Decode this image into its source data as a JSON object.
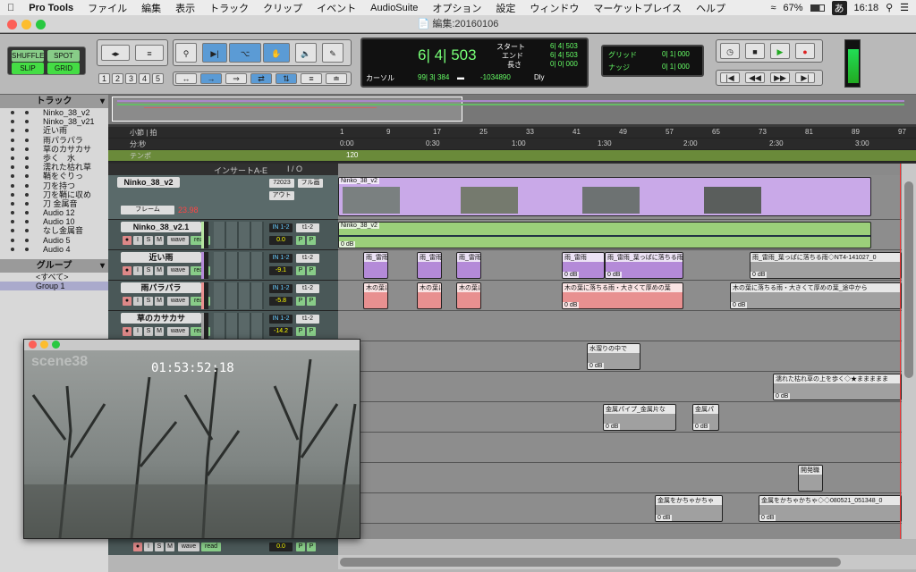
{
  "menubar": {
    "app": "Pro Tools",
    "items": [
      "ファイル",
      "編集",
      "表示",
      "トラック",
      "クリップ",
      "イベント",
      "AudioSuite",
      "オプション",
      "設定",
      "ウィンドウ",
      "マーケットプレイス",
      "ヘルプ"
    ],
    "battery": "67%",
    "input_lang": "あ",
    "clock": "16:18"
  },
  "window": {
    "title": "編集:20160106"
  },
  "modes": {
    "shuffle": "SHUFFLE",
    "spot": "SPOT",
    "slip": "SLIP",
    "grid": "GRID"
  },
  "zoom_presets": [
    "1",
    "2",
    "3",
    "4",
    "5"
  ],
  "counter": {
    "main": "6| 4| 503",
    "start_label": "スタート",
    "end_label": "エンド",
    "length_label": "長さ",
    "start": "6| 4| 503",
    "end": "6| 4| 503",
    "length": "0| 0| 000",
    "cursor_label": "カーソル",
    "cursor": "99| 3| 384",
    "offset": "-1034890",
    "dly": "Dly"
  },
  "grid": {
    "grid_label": "グリッド",
    "grid_value": "0| 1| 000",
    "nudge_label": "ナッジ",
    "nudge_value": "0| 1| 000"
  },
  "tracks_panel": {
    "title": "トラック",
    "items": [
      "Ninko_38_v2",
      "Ninko_38_v21",
      "近い雨",
      "雨パラパラ",
      "草のカサカサ",
      "歩く　水",
      "濡れた枯れ草",
      "鞘をぐりっ",
      "刀を持つ",
      "刀を鞘に収め",
      "刀 金属音",
      "Audio 12",
      "Audio 10",
      "なし金属音",
      "Audio 5",
      "Audio 4"
    ]
  },
  "groups_panel": {
    "title": "グループ",
    "items": [
      "<すべて>",
      "Group 1"
    ]
  },
  "rulers": {
    "bars_label": "小節 | 拍",
    "mins_label": "分:秒",
    "tempo_label": "テンポ",
    "tempo_value": "120",
    "bars": [
      "1",
      "9",
      "17",
      "25",
      "33",
      "41",
      "49",
      "57",
      "65",
      "73",
      "81",
      "89",
      "97"
    ],
    "mins": [
      "0:00",
      "0:30",
      "1:00",
      "1:30",
      "2:00",
      "2:30",
      "3:00"
    ]
  },
  "mix_header": {
    "inserts": "インサートA-E",
    "io": "I / O"
  },
  "tracks": [
    {
      "name": "Ninko_38_v2",
      "tc": "72023",
      "full": "フル画",
      "out": "アウト",
      "frame": "フレーム",
      "fps": "23.98"
    },
    {
      "name": "Ninko_38_v2.1",
      "input": "IN 1-2",
      "out": "t1-2",
      "vol": "0.0"
    },
    {
      "name": "近い雨",
      "input": "IN 1-2",
      "out": "t1-2",
      "vol": "-9.1"
    },
    {
      "name": "雨パラパラ",
      "input": "IN 1-2",
      "out": "t1-2",
      "vol": "-5.8"
    },
    {
      "name": "草のカサカサ",
      "input": "IN 1-2",
      "out": "t1-2",
      "vol": "-14.2"
    }
  ],
  "track_buttons": {
    "rec": "●",
    "input": "I",
    "solo": "S",
    "mute": "M",
    "wave": "wave",
    "read": "read",
    "pan": "P"
  },
  "bottom_track": {
    "vol": "0.0"
  },
  "clips": {
    "video": "Ninko_38_v2",
    "audio1": "Ninko_38_v2",
    "db": "0 dB",
    "ame1": "雨_雷雨",
    "ame2": "雨_雷雨_葉っぱに落ちる雨",
    "ame3": "雨_雷雨_葉っぱに落ちる雨◇NT4-141027_0",
    "ki1": "木の葉に落ちる雨・大きくて厚めの葉",
    "ki2": "木の葉に落ちる雨・大きくて厚めの葉_途中から",
    "mizu": "水溜りの中で",
    "kare": "濡れた枯れ草の上を歩く◇★ままままま",
    "kinzoku1": "金属パイプ_金属片な",
    "kinzoku2": "金属パ",
    "ketsu": "開発職",
    "kaka1": "金属をかちゃかちゃ",
    "kaka2": "金属をかちゃかちゃ◇◇080521_051348_0"
  },
  "video_window": {
    "watermark": "scene38",
    "timecode": "01:53:52:18"
  }
}
